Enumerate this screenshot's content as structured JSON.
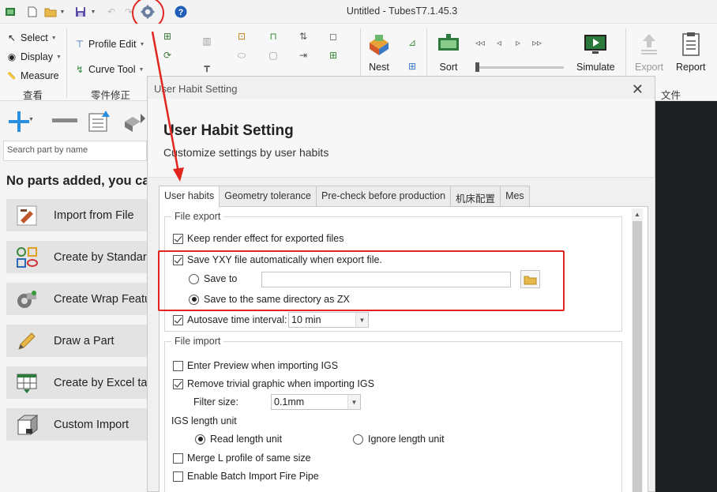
{
  "window": {
    "title": "Untitled - TubesT7.1.45.3"
  },
  "quick_access": {
    "icons": [
      "app-logo-icon",
      "new-file-icon",
      "open-folder-icon",
      "dropdown-icon",
      "save-icon",
      "dropdown-icon",
      "undo-icon",
      "redo-icon",
      "settings-gear-icon",
      "help-icon"
    ],
    "help_glyph": "?"
  },
  "ribbon": {
    "view_group": {
      "select": "Select",
      "display": "Display",
      "measure": "Measure",
      "label": "查看"
    },
    "part_edit_group": {
      "profile_edit": "Profile Edit",
      "curve_tool": "Curve Tool",
      "label": "零件修正"
    },
    "nest": "Nest",
    "sort": "Sort",
    "simulate": "Simulate",
    "export": "Export",
    "report": "Report",
    "file_group_label": "文件"
  },
  "left_panel": {
    "search_placeholder": "Search part by name",
    "empty_message": "No parts added, you can",
    "buttons": [
      {
        "label": "Import from File",
        "icon": "import-file-icon"
      },
      {
        "label": "Create by Standard",
        "icon": "standard-shapes-icon"
      },
      {
        "label": "Create Wrap Feature",
        "icon": "wrap-pipe-icon"
      },
      {
        "label": "Draw a Part",
        "icon": "pencil-icon"
      },
      {
        "label": "Create by Excel table",
        "icon": "excel-table-icon"
      },
      {
        "label": "Custom Import",
        "icon": "custom-import-icon"
      }
    ]
  },
  "dialog": {
    "window_title": "User Habit Setting",
    "close_glyph": "✕",
    "heading": "User Habit Setting",
    "subheading": "Customize settings by user habits",
    "tabs": [
      "User habits",
      "Geometry tolerance",
      "Pre-check before production",
      "机床配置",
      "Mes"
    ],
    "active_tab": "User habits",
    "file_export": {
      "title": "File export",
      "keep_render": {
        "label": "Keep render effect for exported files",
        "checked": true
      },
      "save_yxy": {
        "label": "Save YXY file automatically  when export file.",
        "checked": true
      },
      "save_to": {
        "label": "Save to",
        "selected": false,
        "path_value": ""
      },
      "save_same_dir": {
        "label": "Save to the same directory as ZX",
        "selected": true
      },
      "autosave": {
        "label": "Autosave time interval:",
        "checked": true,
        "value": "10 min"
      }
    },
    "file_import": {
      "title": "File import",
      "enter_preview": {
        "label": "Enter Preview when importing IGS",
        "checked": false
      },
      "remove_trivial": {
        "label": "Remove trivial graphic when importing IGS",
        "checked": true
      },
      "filter_size": {
        "label": "Filter size:",
        "value": "0.1mm"
      },
      "igs_length_unit": {
        "label": "IGS length unit",
        "options": [
          "Read length unit",
          "Ignore length unit"
        ],
        "selected": "Read length unit"
      },
      "merge_l_profile": {
        "label": "Merge L profile of same size",
        "checked": false
      },
      "batch_fire_pipe": {
        "label": "Enable Batch Import Fire Pipe",
        "checked": false
      }
    }
  },
  "annotations": {
    "highlight_color": "#e0261f"
  }
}
